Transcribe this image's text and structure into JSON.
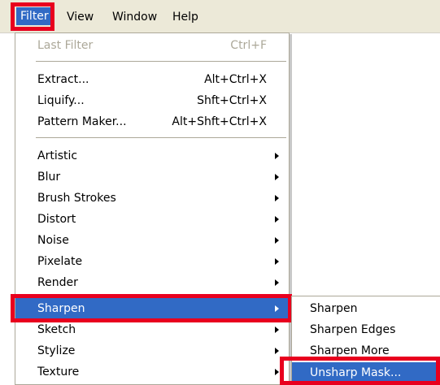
{
  "menubar": {
    "items": [
      "Filter",
      "View",
      "Window",
      "Help"
    ]
  },
  "filter_menu": {
    "last_filter": {
      "label": "Last Filter",
      "shortcut": "Ctrl+F"
    },
    "extract": {
      "label": "Extract...",
      "shortcut": "Alt+Ctrl+X"
    },
    "liquify": {
      "label": "Liquify...",
      "shortcut": "Shft+Ctrl+X"
    },
    "pattern_maker": {
      "label": "Pattern Maker...",
      "shortcut": "Alt+Shft+Ctrl+X"
    },
    "submenus": [
      "Artistic",
      "Blur",
      "Brush Strokes",
      "Distort",
      "Noise",
      "Pixelate",
      "Render",
      "Sharpen",
      "Sketch",
      "Stylize",
      "Texture"
    ]
  },
  "sharpen_submenu": {
    "items": [
      "Sharpen",
      "Sharpen Edges",
      "Sharpen More",
      "Unsharp Mask..."
    ]
  },
  "colors": {
    "highlight": "#316ac5",
    "callout_border": "#e8001e"
  }
}
